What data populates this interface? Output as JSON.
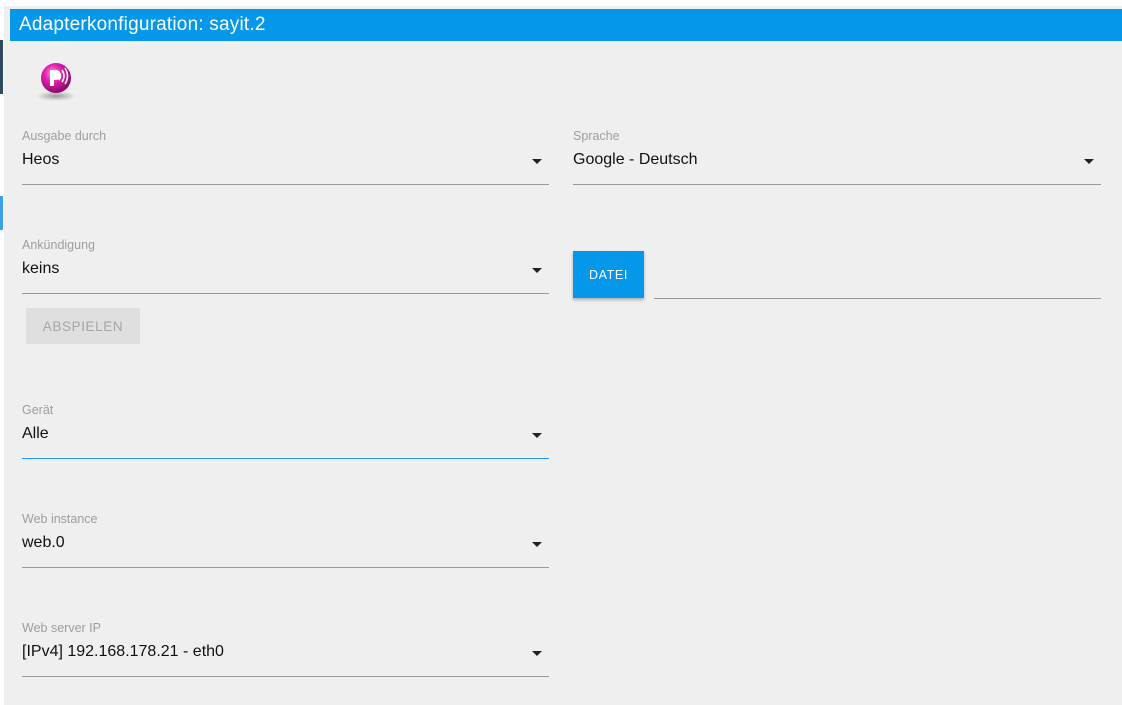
{
  "window": {
    "title": "Adapterkonfiguration: sayit.2"
  },
  "logo": {
    "icon": "sayit-logo-icon",
    "colors": {
      "primary": "#e020b0",
      "accent": "#ffffff"
    }
  },
  "fields": {
    "ausgabe": {
      "label": "Ausgabe durch",
      "value": "Heos"
    },
    "sprache": {
      "label": "Sprache",
      "value": "Google - Deutsch"
    },
    "ankuendigung": {
      "label": "Ankündigung",
      "value": "keins"
    },
    "geraet": {
      "label": "Gerät",
      "value": "Alle"
    },
    "web_instance": {
      "label": "Web instance",
      "value": "web.0"
    },
    "web_server_ip": {
      "label": "Web server IP",
      "value": "[IPv4] 192.168.178.21 - eth0"
    }
  },
  "buttons": {
    "datei": "DATEI",
    "abspielen": "ABSPIELEN"
  },
  "colors": {
    "accent": "#0497ea",
    "background": "#efefef",
    "focus_underline": "#2196f3"
  }
}
